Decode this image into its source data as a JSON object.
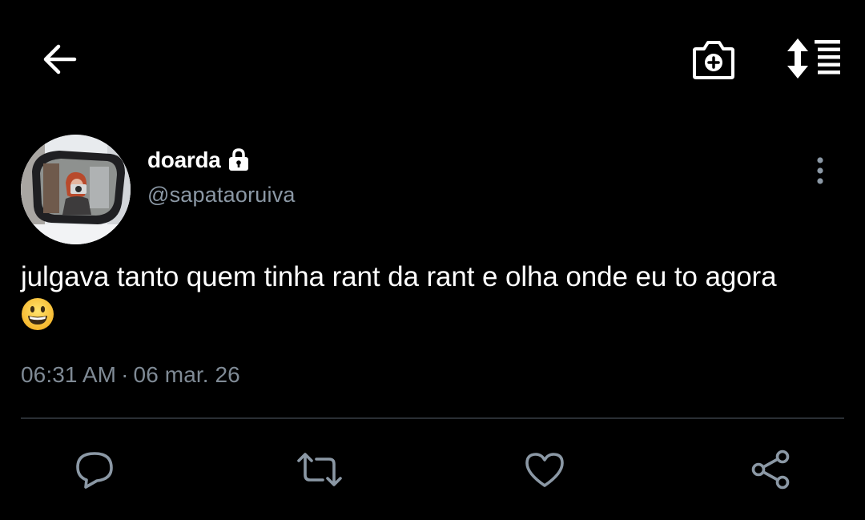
{
  "header": {
    "back_icon": "arrow-left-icon",
    "camera_icon": "camera-plus-icon",
    "sort_icon": "sort-timeline-icon"
  },
  "author": {
    "display_name": "doarda",
    "protected_icon": "lock-icon",
    "handle": "@sapataoruiva"
  },
  "tweet": {
    "text": "julgava tanto quem tinha rant da rant e olha onde eu to agora",
    "emoji": "😀",
    "time": "06:31 AM",
    "separator": "·",
    "date": "06 mar. 26"
  },
  "actions": {
    "reply_icon": "reply-icon",
    "retweet_icon": "retweet-icon",
    "like_icon": "heart-icon",
    "share_icon": "share-icon"
  },
  "colors": {
    "background": "#000000",
    "text_primary": "#ffffff",
    "text_secondary": "#8b98a5",
    "divider": "#2a2f34"
  }
}
